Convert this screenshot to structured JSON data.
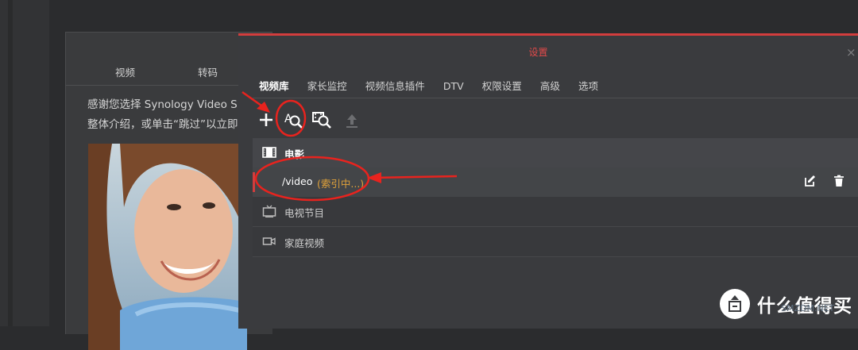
{
  "wizard": {
    "tabs": [
      "视频",
      "转码"
    ],
    "intro_line1": "感谢您选择 Synology Video S",
    "intro_line2": "整体介绍，或单击“跳过”以立即"
  },
  "dialog": {
    "title": "设置",
    "close": "×",
    "tabs": [
      "视频库",
      "家长监控",
      "视频信息插件",
      "DTV",
      "权限设置",
      "高级",
      "选项"
    ],
    "active_tab": "视频库"
  },
  "toolbar": {
    "add_icon": "plus-icon",
    "scan_icon": "index-search-icon",
    "rescan_icon": "media-search-icon",
    "upload_icon": "upload-icon"
  },
  "library": {
    "header": {
      "label": "电影",
      "icon": "film-icon"
    },
    "selected_row": {
      "path": "/video",
      "status": "(索引中...)"
    },
    "rows": [
      {
        "label": "电视节目",
        "icon": "tv-icon"
      },
      {
        "label": "家庭视频",
        "icon": "camera-icon"
      }
    ],
    "actions": [
      "edit-icon",
      "delete-icon"
    ]
  },
  "watermark": {
    "text": "什么值得买",
    "sub": "SMZDM.NET"
  },
  "colors": {
    "accent_red": "#d23d3d",
    "status_orange": "#e0a23a",
    "annotation_red": "#e8231e"
  }
}
